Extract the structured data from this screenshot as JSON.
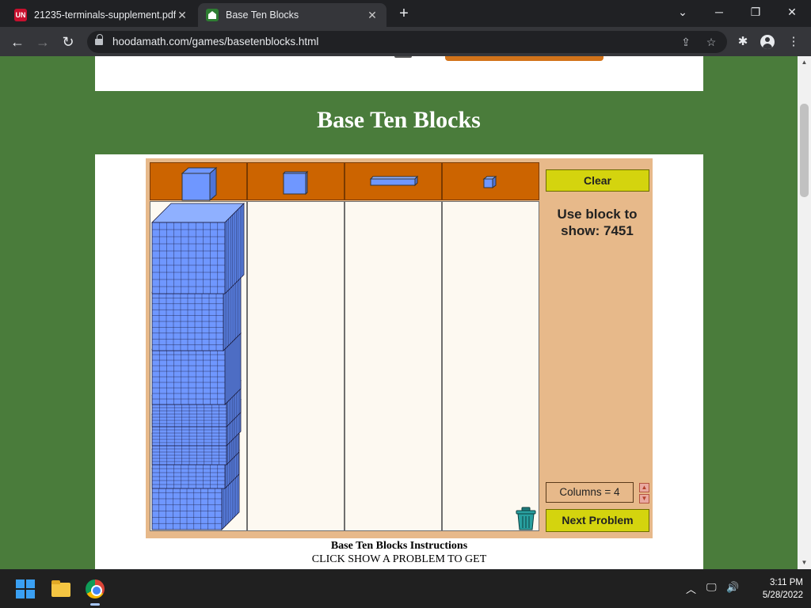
{
  "browser": {
    "tabs": [
      {
        "title": "21235-terminals-supplement.pdf",
        "favicon": "UN",
        "active": false
      },
      {
        "title": "Base Ten Blocks",
        "active": true
      }
    ],
    "new_tab": "+",
    "url": "hoodamath.com/games/basetenblocks.html",
    "window_controls": {
      "chevron": "⌄",
      "minimize": "─",
      "restore": "❐",
      "close": "✕"
    },
    "nav": {
      "back": "←",
      "forward": "→",
      "reload": "↻"
    },
    "icons": {
      "share": "⇪",
      "star": "☆",
      "extensions": "✱",
      "menu": "⋮"
    }
  },
  "page": {
    "title": "Base Ten Blocks"
  },
  "game": {
    "clear_label": "Clear",
    "problem_text": "Use block to show: 7451",
    "columns_text": "Columns = 4",
    "next_label": "Next Problem",
    "arrow_up": "▲",
    "arrow_down": "▼",
    "palette": [
      "thousand-cube",
      "hundred-flat",
      "ten-rod",
      "one-unit"
    ],
    "block_color": "#6f97ff",
    "header_color": "#cc6400",
    "panel_color": "#e7b98a"
  },
  "instructions": {
    "title": "Base Ten Blocks Instructions",
    "line1": "CLICK SHOW A PROBLEM TO GET"
  },
  "taskbar": {
    "time": "3:11 PM",
    "date": "5/28/2022",
    "tray_chevron": "︿",
    "tray_network": "🖵",
    "tray_volume": "🔊"
  }
}
